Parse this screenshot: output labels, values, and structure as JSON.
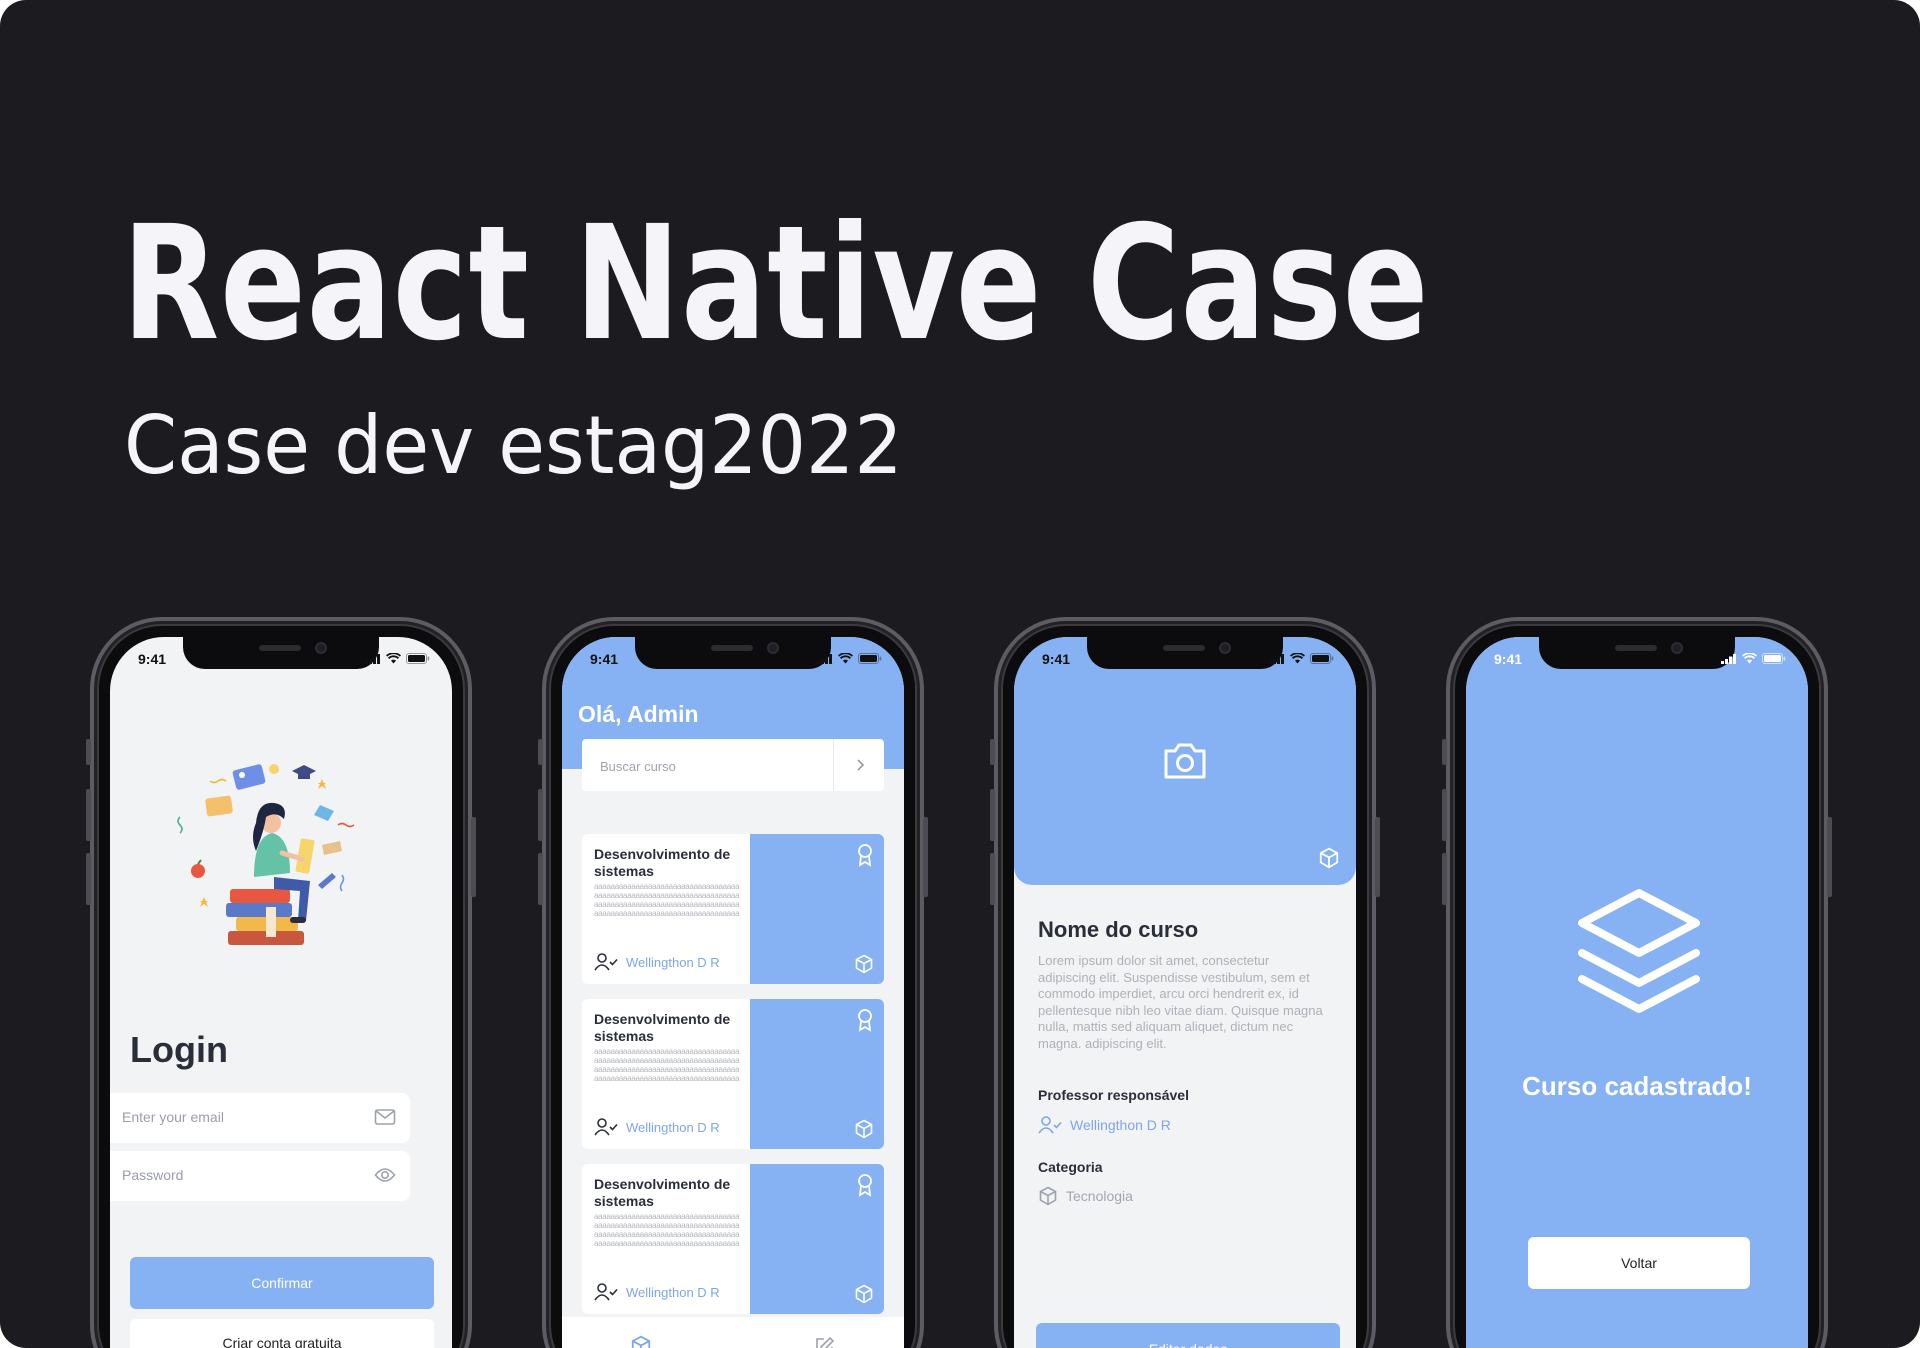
{
  "hero": {
    "title": "React Native Case",
    "subtitle": "Case dev estag2022"
  },
  "colors": {
    "background": "#1b1b20",
    "accent": "#86b1f2",
    "screen_bg": "#f2f3f5",
    "author_link": "#7ea5ea"
  },
  "status_bar": {
    "time": "9:41"
  },
  "login_screen": {
    "title": "Login",
    "email_placeholder": "Enter your email",
    "password_placeholder": "Password",
    "confirm_label": "Confirmar",
    "create_account_label": "Criar conta gratuita",
    "icons": [
      "illustration-woman-reading",
      "mail-icon",
      "eye-icon"
    ]
  },
  "course_list_screen": {
    "greeting": "Olá, Admin",
    "search_placeholder": "Buscar curso",
    "cards": [
      {
        "title": "Desenvolvimento de sistemas",
        "description": "aaaaaaaaaaaaaaaaaaaaaaaaaaaaaaaaaaaaaaaaaaaaaaaaaaaaaaaaaaaaaaaaaaaaaaaaaaaaaaaaaaaaaaaaaaaaaaaaaaaaaaaaaaaaaaaaaaaaaaaaaaaaaaaaaaaaaaaaaaaaaaaaaaaaaaaa",
        "author": "Wellingthon D R"
      },
      {
        "title": "Desenvolvimento de sistemas",
        "description": "aaaaaaaaaaaaaaaaaaaaaaaaaaaaaaaaaaaaaaaaaaaaaaaaaaaaaaaaaaaaaaaaaaaaaaaaaaaaaaaaaaaaaaaaaaaaaaaaaaaaaaaaaaaaaaaaaaaaaaaaaaaaaaaaaaaaaaaaaaaaaaaaaaaaaaaa",
        "author": "Wellingthon D R"
      },
      {
        "title": "Desenvolvimento de sistemas",
        "description": "aaaaaaaaaaaaaaaaaaaaaaaaaaaaaaaaaaaaaaaaaaaaaaaaaaaaaaaaaaaaaaaaaaaaaaaaaaaaaaaaaaaaaaaaaaaaaaaaaaaaaaaaaaaaaaaaaaaaaaaaaaaaaaaaaaaaaaaaaaaaaaaaaaaaaaaa",
        "author": "Wellingthon D R"
      }
    ],
    "tab_icons": [
      "cube-icon",
      "edit-icon"
    ]
  },
  "course_detail_screen": {
    "course_name": "Nome do curso",
    "description": "Lorem ipsum dolor sit amet, consectetur adipiscing elit. Suspendisse vestibulum, sem et commodo imperdiet, arcu orci hendrerit ex, id pellentesque nibh leo vitae diam. Quisque magna nulla, mattis sed aliquam aliquet, dictum nec magna. adipiscing elit.",
    "teacher_label": "Professor responsável",
    "teacher_name": "Wellingthon D R",
    "category_label": "Categoria",
    "category_value": "Tecnologia",
    "edit_label": "Editar dados"
  },
  "success_screen": {
    "message": "Curso cadastrado!",
    "back_label": "Voltar"
  }
}
